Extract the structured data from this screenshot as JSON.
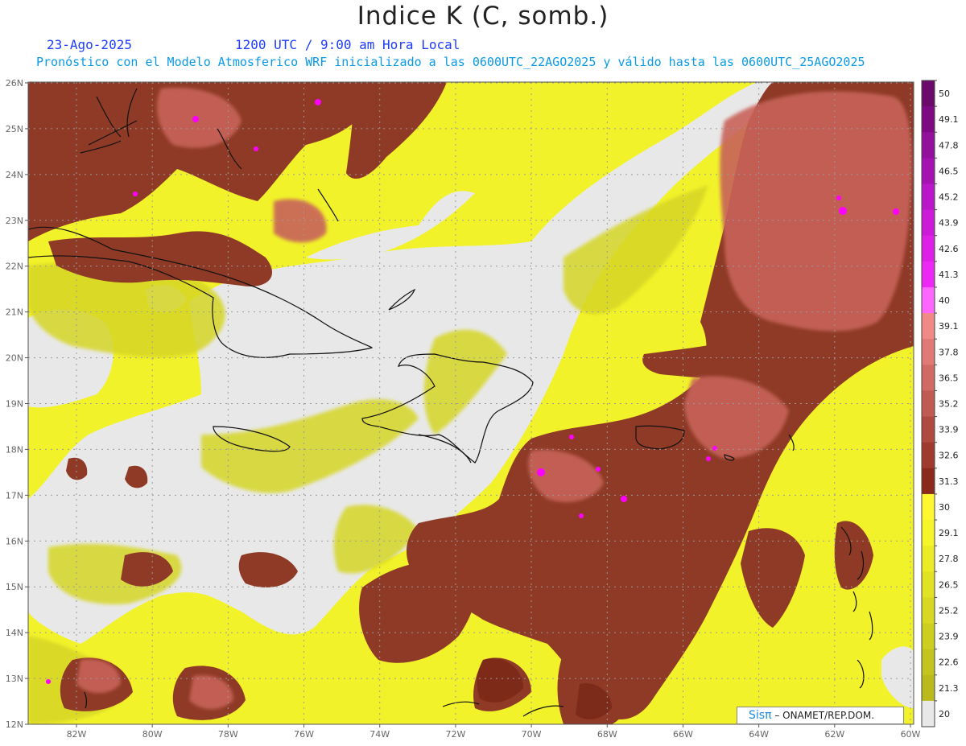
{
  "title": "Indice K (C, somb.)",
  "date_label": "23-Ago-2025",
  "time_label": "1200 UTC / 9:00 am Hora Local",
  "description": "Pronóstico con el Modelo Atmosferico WRF inicializado a las 0600UTC_22AGO2025 y válido hasta las  0600UTC_25AGO2025",
  "credit": {
    "brand": "Sisπ",
    "text": " – ONAMET/REP.DOM."
  },
  "lat_labels": [
    "26N",
    "25N",
    "24N",
    "23N",
    "22N",
    "21N",
    "20N",
    "19N",
    "18N",
    "17N",
    "16N",
    "15N",
    "14N",
    "13N",
    "12N"
  ],
  "lon_labels": [
    "82W",
    "80W",
    "78W",
    "76W",
    "74W",
    "72W",
    "70W",
    "68W",
    "66W",
    "64W",
    "62W",
    "60W"
  ],
  "colorbar": {
    "labels": [
      "50",
      "49.1",
      "47.8",
      "46.5",
      "45.2",
      "43.9",
      "42.6",
      "41.3",
      "40",
      "39.1",
      "37.8",
      "36.5",
      "35.2",
      "33.9",
      "32.6",
      "31.3",
      "30",
      "29.1",
      "27.8",
      "26.5",
      "25.2",
      "23.9",
      "22.6",
      "21.3",
      "20"
    ],
    "colors": [
      "#6a0a6a",
      "#7d0a82",
      "#92109a",
      "#a612b2",
      "#ba16ca",
      "#cc1ad8",
      "#de20e6",
      "#ee28f4",
      "#ff66ff",
      "#f08a86",
      "#e07a76",
      "#d06a64",
      "#c05a52",
      "#b04a40",
      "#a03a2e",
      "#8a2a1c",
      "#fff830",
      "#f6f52a",
      "#ecec26",
      "#e2e224",
      "#d8d822",
      "#cece20",
      "#c4c41e",
      "#baba1c",
      "#e8e8e8"
    ]
  },
  "colors": {
    "no_data": "#e8e8e8",
    "yellow": "#f2f22a",
    "olive": "#cfcf2a",
    "brown": "#8e3a26",
    "salmon": "#c8645a",
    "magenta": "#ff00ff",
    "coast": "#111111"
  }
}
